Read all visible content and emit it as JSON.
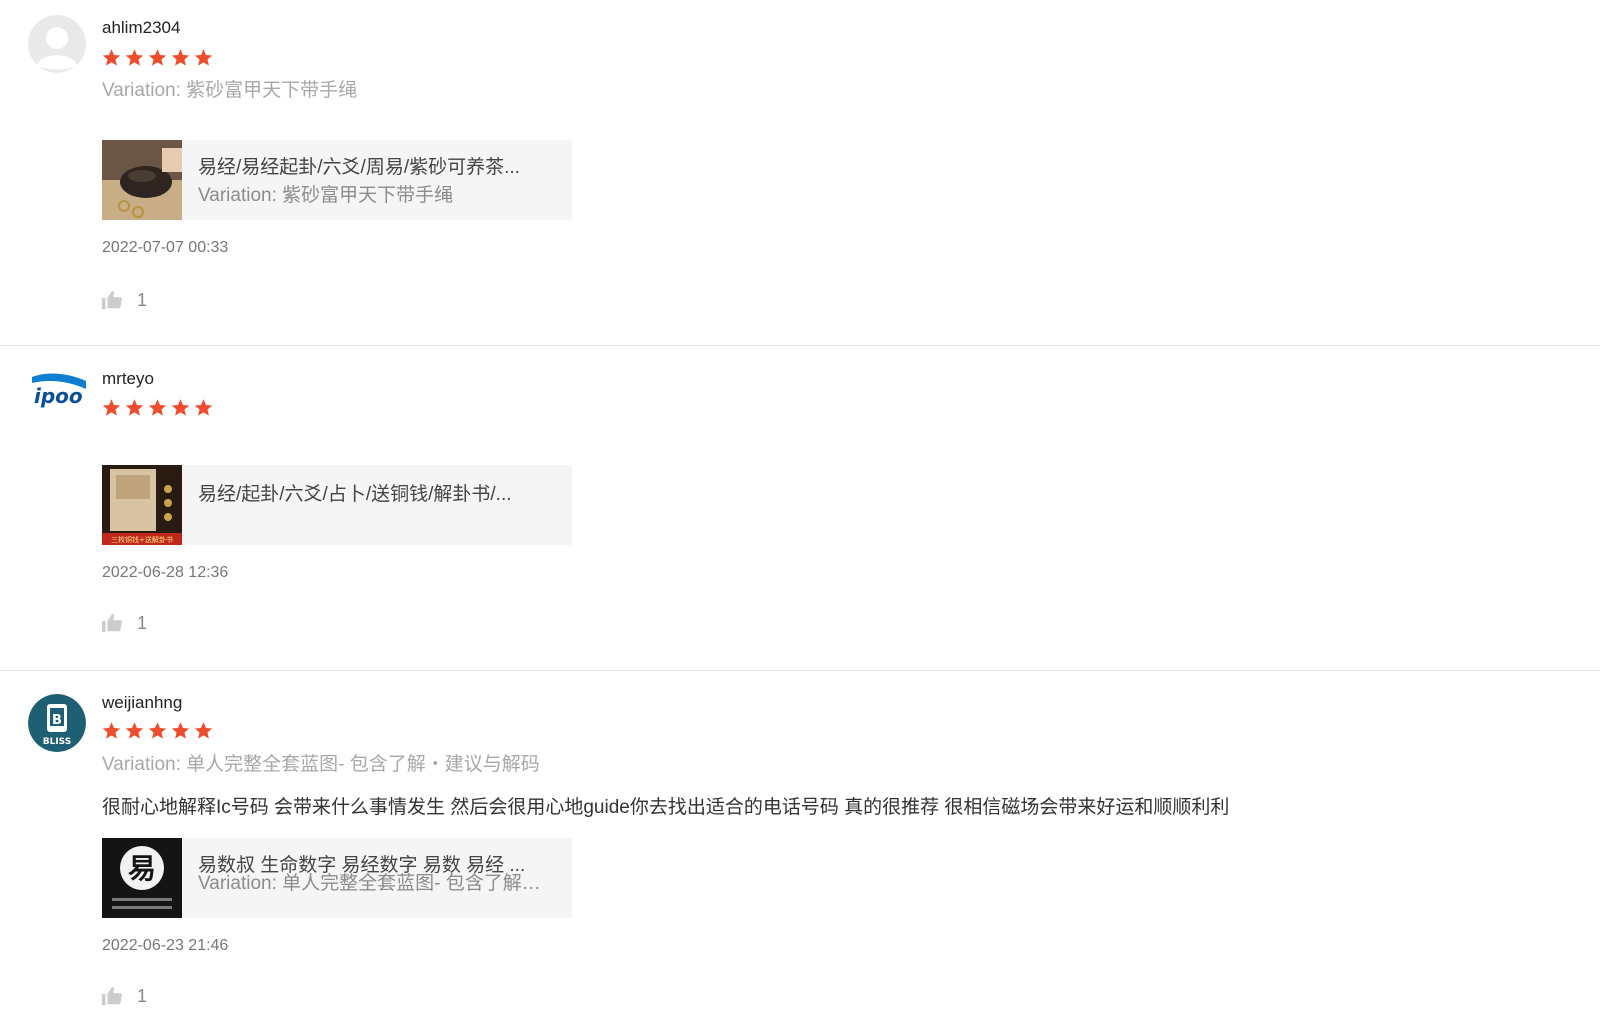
{
  "reviews": [
    {
      "username": "ahlim2304",
      "rating": 5,
      "variation": "Variation: 紫砂富甲天下带手绳",
      "comment": "",
      "product": {
        "title": "易经/易经起卦/六爻/周易/紫砂可养茶...",
        "variation": "Variation: 紫砂富甲天下带手绳"
      },
      "timestamp": "2022-07-07 00:33",
      "likes": "1"
    },
    {
      "username": "mrteyo",
      "rating": 5,
      "variation": "",
      "comment": "",
      "product": {
        "title": "易经/起卦/六爻/占卜/送铜钱/解卦书/...",
        "variation": ""
      },
      "timestamp": "2022-06-28 12:36",
      "likes": "1"
    },
    {
      "username": "weijianhng",
      "rating": 5,
      "variation": "Variation: 单人完整全套蓝图- 包含了解・建议与解码",
      "comment": "很耐心地解释Ic号码 会带来什么事情发生 然后会很用心地guide你去找出适合的电话号码 真的很推荐 很相信磁场会带来好运和顺顺利利",
      "product": {
        "title": "易数叔 生命数字 易经数字 易数 易经 ...",
        "variation": "Variation: 单人完整全套蓝图- 包含了解・建议与解码"
      },
      "timestamp": "2022-06-23 21:46",
      "likes": "1"
    }
  ],
  "avatars": {
    "r2_logo_text": "ipoo",
    "r3_logo_text": "BLISS"
  },
  "thumbnails": {
    "r2_banner": "三枚铜钱+送解卦书",
    "r3_char": "易"
  },
  "colors": {
    "star": "#ee4d2d",
    "divider": "#e6e6e6",
    "product_bg": "#f5f5f5"
  }
}
